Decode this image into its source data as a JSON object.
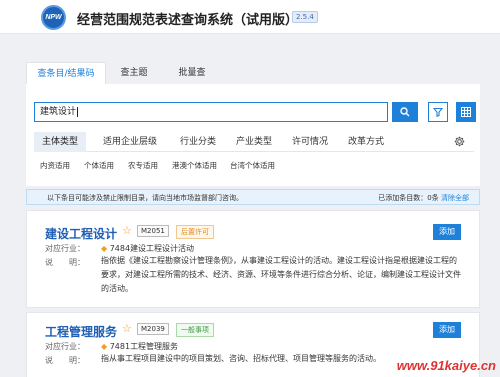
{
  "app": {
    "logo_text": "NPW",
    "title": "经营范围规范表述查询系统（试用版）",
    "version": "2.5.4"
  },
  "tabs": [
    {
      "label": "查条目/结果码",
      "active": true
    },
    {
      "label": "查主题",
      "active": false
    },
    {
      "label": "批量查",
      "active": false
    }
  ],
  "search": {
    "value": "建筑设计"
  },
  "categories": [
    {
      "label": "主体类型",
      "active": true
    },
    {
      "label": "适用企业层级"
    },
    {
      "label": "行业分类"
    },
    {
      "label": "产业类型"
    },
    {
      "label": "许可情况"
    },
    {
      "label": "改革方式"
    }
  ],
  "sub_options": [
    "内资适用",
    "个体适用",
    "农专适用",
    "港澳个体适用",
    "台湾个体适用"
  ],
  "notice": {
    "text": "以下条目可能涉及禁止限制目录，请向当地市场监督部门咨询。",
    "added_label": "已添加条目数：0条",
    "clear_label": "清除全部"
  },
  "labels": {
    "industry": "对应行业：",
    "description": "说　　明：",
    "add": "添加"
  },
  "results": [
    {
      "title": "建设工程设计",
      "code": "M2051",
      "badge": "后置许可",
      "industry": "7484建设工程设计活动",
      "description": "指依据《建设工程勘察设计管理条例》，从事建设工程设计的活动。建设工程设计指是根据建设工程的要求，对建设工程所需的技术、经济、资源、环境等条件进行综合分析、论证，编制建设工程设计文件的活动。"
    },
    {
      "title": "工程管理服务",
      "code": "M2039",
      "badge": "一般事项",
      "industry": "7481工程管理服务",
      "description": "指从事工程项目建设中的项目策划、咨询、招标代理、项目管理等服务的活动。"
    }
  ],
  "watermark": "www.91kaiye.cn",
  "colors": {
    "accent": "#1e80d8",
    "title_blue": "#1e5fb5",
    "later_badge": "#e08a1a",
    "normal_badge": "#3a9a3a"
  }
}
